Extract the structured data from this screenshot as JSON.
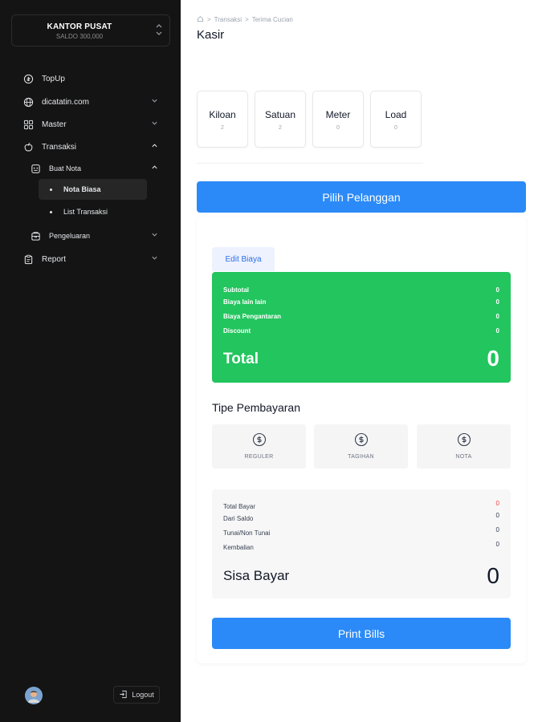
{
  "sidebar": {
    "store": {
      "name": "KANTOR PUSAT",
      "saldo": "SALDO 300,000"
    },
    "items": [
      {
        "label": "TopUp",
        "icon": "money-circle-icon"
      },
      {
        "label": "dicatatin.com",
        "icon": "globe-icon"
      },
      {
        "label": "Master",
        "icon": "grid-icon"
      },
      {
        "label": "Transaksi",
        "icon": "apple-icon"
      }
    ],
    "transaksi": {
      "buat_nota": "Buat Nota",
      "nota_biasa": "Nota Biasa",
      "list_transaksi": "List Transaksi",
      "pengeluaran": "Pengeluaran"
    },
    "report": "Report",
    "logout": "Logout"
  },
  "breadcrumb": {
    "home": "home-icon",
    "item1": "Transaksi",
    "item2": "Terima Cucian"
  },
  "page_title": "Kasir",
  "units": [
    {
      "label": "Kiloan",
      "count": "2"
    },
    {
      "label": "Satuan",
      "count": "2"
    },
    {
      "label": "Meter",
      "count": "0"
    },
    {
      "label": "Load",
      "count": "0"
    }
  ],
  "pilih_pelanggan": "Pilih Pelanggan",
  "edit_biaya": "Edit Biaya",
  "costs": {
    "subtotal_label": "Subtotal",
    "subtotal": "0",
    "lain_label": "Biaya lain lain",
    "lain": "0",
    "antar_label": "Biaya Pengantaran",
    "antar": "0",
    "discount_label": "Discount",
    "discount": "0",
    "total_label": "Total",
    "total": "0"
  },
  "payment": {
    "title": "Tipe Pembayaran",
    "types": [
      "REGULER",
      "TAGIHAN",
      "NOTA"
    ]
  },
  "summary": {
    "total_bayar_label": "Total Bayar",
    "total_bayar": "0",
    "dari_saldo_label": "Dari Saldo",
    "dari_saldo": "0",
    "tunai_label": "Tunai/Non Tunai",
    "tunai": "0",
    "kembalian_label": "Kembalian",
    "kembalian": "0",
    "sisa_label": "Sisa Bayar",
    "sisa": "0"
  },
  "print_bills": "Print Bills",
  "colors": {
    "primary": "#2b8af7",
    "success": "#22c55e",
    "sidebar": "#141414",
    "danger": "#ef4444"
  }
}
